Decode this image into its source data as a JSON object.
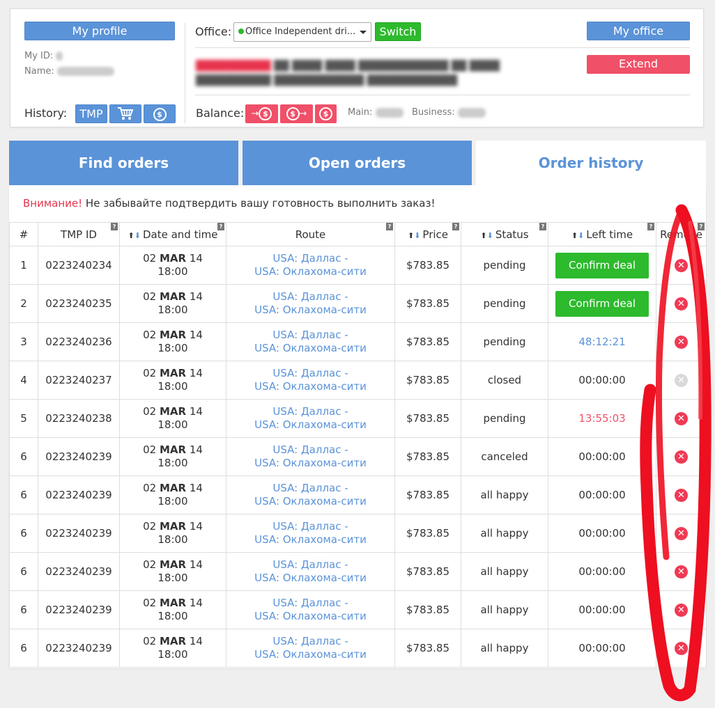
{
  "profile": {
    "my_profile_label": "My profile",
    "my_id_label": "My ID:",
    "name_label": "Name:",
    "history_label": "History:",
    "history_tmp_label": "TMP"
  },
  "office": {
    "label": "Office:",
    "selected": "Office Independent dri...",
    "switch_label": "Switch",
    "my_office_label": "My office",
    "extend_label": "Extend"
  },
  "balance": {
    "label": "Balance:",
    "main_label": "Main:",
    "business_label": "Business:"
  },
  "tabs": [
    {
      "label": "Find orders",
      "active": false
    },
    {
      "label": "Open orders",
      "active": false
    },
    {
      "label": "Order history",
      "active": true
    }
  ],
  "warning": {
    "prefix": "Внимание!",
    "text": " Не забывайте подтвердить вашу готовность выполнить заказ!"
  },
  "table": {
    "headers": {
      "num": "#",
      "tmp_id": "TMP ID",
      "date": "Date and time",
      "route": "Route",
      "price": "Price",
      "status": "Status",
      "left_time": "Left time",
      "remove": "Remove"
    },
    "help_mark": "?",
    "rows": [
      {
        "num": "1",
        "tmp_id": "0223240234",
        "day": "02",
        "mon": "MAR",
        "year": "14",
        "time": "18:00",
        "from": "USA: Даллас -",
        "to": "USA: Оклахома-сити",
        "price": "$783.85",
        "status": "pending",
        "left": "",
        "action": "Confirm deal",
        "left_style": "button",
        "remove": "active"
      },
      {
        "num": "2",
        "tmp_id": "0223240235",
        "day": "02",
        "mon": "MAR",
        "year": "14",
        "time": "18:00",
        "from": "USA: Даллас -",
        "to": "USA: Оклахома-сити",
        "price": "$783.85",
        "status": "pending",
        "left": "",
        "action": "Confirm deal",
        "left_style": "button",
        "remove": "active"
      },
      {
        "num": "3",
        "tmp_id": "0223240236",
        "day": "02",
        "mon": "MAR",
        "year": "14",
        "time": "18:00",
        "from": "USA: Даллас -",
        "to": "USA: Оклахома-сити",
        "price": "$783.85",
        "status": "pending",
        "left": "48:12:21",
        "action": "",
        "left_style": "blue",
        "remove": "active"
      },
      {
        "num": "4",
        "tmp_id": "0223240237",
        "day": "02",
        "mon": "MAR",
        "year": "14",
        "time": "18:00",
        "from": "USA: Даллас -",
        "to": "USA: Оклахома-сити",
        "price": "$783.85",
        "status": "closed",
        "left": "00:00:00",
        "action": "",
        "left_style": "normal",
        "remove": "disabled"
      },
      {
        "num": "5",
        "tmp_id": "0223240238",
        "day": "02",
        "mon": "MAR",
        "year": "14",
        "time": "18:00",
        "from": "USA: Даллас -",
        "to": "USA: Оклахома-сити",
        "price": "$783.85",
        "status": "pending",
        "left": "13:55:03",
        "action": "",
        "left_style": "red",
        "remove": "active"
      },
      {
        "num": "6",
        "tmp_id": "0223240239",
        "day": "02",
        "mon": "MAR",
        "year": "14",
        "time": "18:00",
        "from": "USA: Даллас -",
        "to": "USA: Оклахома-сити",
        "price": "$783.85",
        "status": "canceled",
        "left": "00:00:00",
        "action": "",
        "left_style": "normal",
        "remove": "active"
      },
      {
        "num": "6",
        "tmp_id": "0223240239",
        "day": "02",
        "mon": "MAR",
        "year": "14",
        "time": "18:00",
        "from": "USA: Даллас -",
        "to": "USA: Оклахома-сити",
        "price": "$783.85",
        "status": "all happy",
        "left": "00:00:00",
        "action": "",
        "left_style": "normal",
        "remove": "active"
      },
      {
        "num": "6",
        "tmp_id": "0223240239",
        "day": "02",
        "mon": "MAR",
        "year": "14",
        "time": "18:00",
        "from": "USA: Даллас -",
        "to": "USA: Оклахома-сити",
        "price": "$783.85",
        "status": "all happy",
        "left": "00:00:00",
        "action": "",
        "left_style": "normal",
        "remove": "active"
      },
      {
        "num": "6",
        "tmp_id": "0223240239",
        "day": "02",
        "mon": "MAR",
        "year": "14",
        "time": "18:00",
        "from": "USA: Даллас -",
        "to": "USA: Оклахома-сити",
        "price": "$783.85",
        "status": "all happy",
        "left": "00:00:00",
        "action": "",
        "left_style": "normal",
        "remove": "active"
      },
      {
        "num": "6",
        "tmp_id": "0223240239",
        "day": "02",
        "mon": "MAR",
        "year": "14",
        "time": "18:00",
        "from": "USA: Даллас -",
        "to": "USA: Оклахома-сити",
        "price": "$783.85",
        "status": "all happy",
        "left": "00:00:00",
        "action": "",
        "left_style": "normal",
        "remove": "active"
      },
      {
        "num": "6",
        "tmp_id": "0223240239",
        "day": "02",
        "mon": "MAR",
        "year": "14",
        "time": "18:00",
        "from": "USA: Даллас -",
        "to": "USA: Оклахома-сити",
        "price": "$783.85",
        "status": "all happy",
        "left": "00:00:00",
        "action": "",
        "left_style": "normal",
        "remove": "active"
      }
    ]
  },
  "icons": {
    "cart": "cart-icon",
    "dollar": "dollar-coin-icon",
    "remove": "remove-x-icon"
  },
  "colors": {
    "blue": "#5b93d8",
    "green": "#2dba2d",
    "red": "#f05068",
    "annotation": "#ee0f20"
  }
}
